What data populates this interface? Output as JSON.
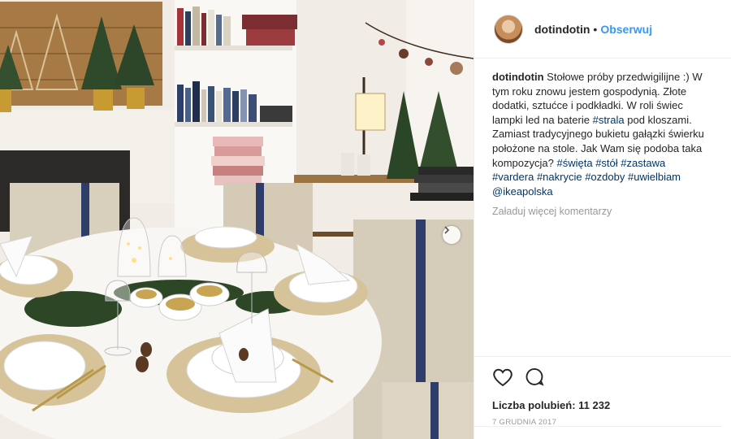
{
  "post": {
    "image_alt_icon": "carousel-next-icon",
    "header": {
      "username": "dotindotin",
      "separator": "•",
      "follow_label": "Obserwuj"
    },
    "caption": {
      "username": "dotindotin",
      "text_1": "Stołowe próby przedwigilijne :) W tym roku znowu jestem gospodynią. Złote dodatki, sztućce i podkładki. W roli świec lampki led na baterie",
      "hashtag_strala": "#strala",
      "text_2": "pod kloszami. Zamiast tradycyjnego bukietu gałązki świerku położone na stole. Jak Wam się podoba taka kompozycja?",
      "tags": [
        "#święta",
        "#stół",
        "#zastawa",
        "#vardera",
        "#nakrycie",
        "#ozdoby",
        "#uwielbiam",
        "@ikeapolska"
      ]
    },
    "load_more_label": "Załaduj więcej komentarzy",
    "actions": {
      "like_icon": "heart-icon",
      "comment_icon": "comment-icon"
    },
    "likes_label": "Liczba polubień: 11 232",
    "date": "7 GRUDNIA 2017"
  },
  "colors": {
    "link": "#003569",
    "follow": "#3897f0",
    "muted": "#999999",
    "text": "#262626"
  }
}
